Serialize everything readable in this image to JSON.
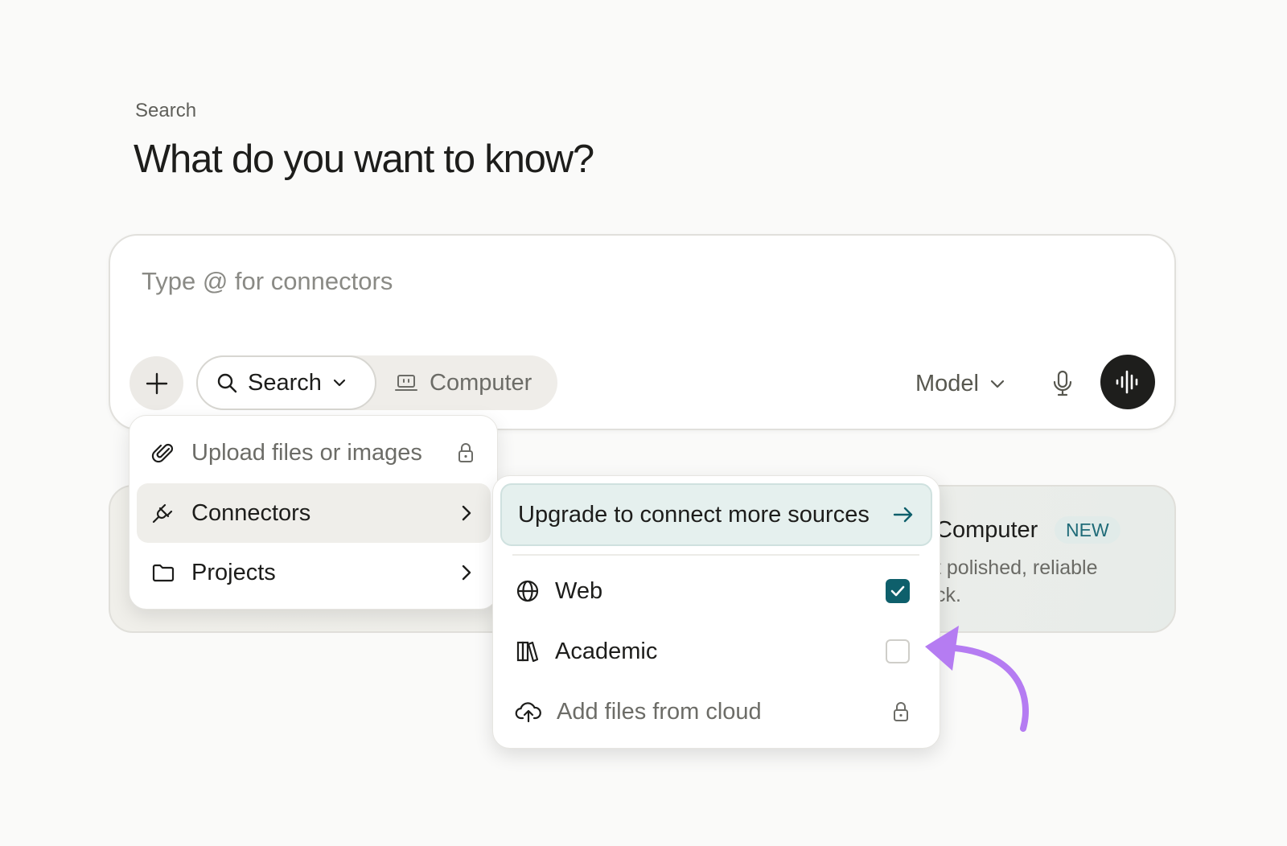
{
  "header": {
    "breadcrumb": "Search",
    "title": "What do you want to know?"
  },
  "composer": {
    "placeholder": "Type @ for connectors",
    "mode_search_label": "Search",
    "mode_computer_label": "Computer",
    "model_label": "Model"
  },
  "plus_menu": {
    "items": [
      {
        "label": "Upload files or images",
        "icon": "paperclip-icon",
        "trail": "lock-icon"
      },
      {
        "label": "Connectors",
        "icon": "plug-icon",
        "trail": "chevron-right-icon"
      },
      {
        "label": "Projects",
        "icon": "folder-icon",
        "trail": "chevron-right-icon"
      }
    ]
  },
  "connectors_menu": {
    "upgrade_label": "Upgrade to connect more sources",
    "sources": [
      {
        "label": "Web",
        "icon": "globe-icon",
        "checked": true
      },
      {
        "label": "Academic",
        "icon": "books-icon",
        "checked": false
      },
      {
        "label": "Add files from cloud",
        "icon": "cloud-upload-icon",
        "locked": true
      }
    ]
  },
  "background_card": {
    "title": "Computer",
    "badge": "NEW",
    "line1": "t polished, reliable",
    "line2": "ck."
  },
  "colors": {
    "background": "#fafaf9",
    "accent_teal": "#0e5f6b",
    "annotation_purple": "#b57cf2",
    "voice_button": "#1e1e1c"
  }
}
